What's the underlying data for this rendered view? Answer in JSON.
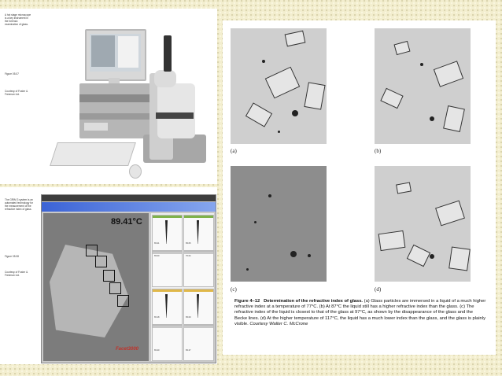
{
  "top_figure": {
    "caption": "A hot stage microscope is a key instrument in the forensic examination of glass.",
    "figure_number": "Figure 05.07",
    "credit": "Courtesy of Foster & Freeman Ltd."
  },
  "bottom_figure": {
    "caption": "The GRIM 3 system is an automated technology for the measurement of the refractive index of glass.",
    "figure_number": "Figure 05.08",
    "credit": "Courtesy of Foster & Freeman Ltd.",
    "software": {
      "temperature": "89.41°C",
      "brand": "Facet3000",
      "panel_values": [
        "65.21",
        "65.05",
        "65.00",
        "70.04",
        "65.18",
        "65.09",
        "65.40",
        "65.27",
        "66.02"
      ]
    }
  },
  "right_figure": {
    "panel_labels": [
      "(a)",
      "(b)",
      "(c)",
      "(d)"
    ],
    "caption_label": "Figure 4–12",
    "caption_title": "Determination of the refractive index of glass.",
    "caption_body": "(a) Glass particles are immersed in a liquid of a much higher refractive index at a temperature of 77°C. (b) At 87°C the liquid still has a higher refractive index than the glass. (c) The refractive index of the liquid is closest to that of the glass at 97°C, as shown by the disappearance of the glass and the Becke lines. (d) At the higher temperature of 117°C, the liquid has a much lower index than the glass, and the glass is plainly visible.",
    "caption_credit": "Courtesy Walter C. McCrone"
  }
}
